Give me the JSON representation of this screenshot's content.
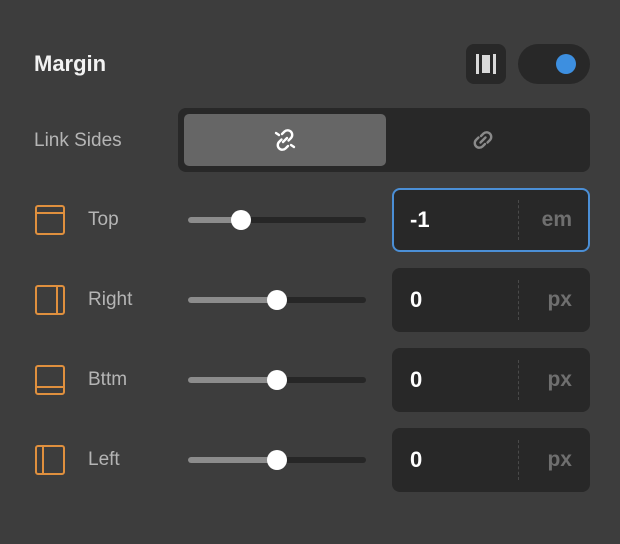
{
  "section": {
    "title": "Margin",
    "spacing_icon": "vertical-spacing-icon",
    "toggle_on": true
  },
  "link_sides": {
    "label": "Link Sides",
    "options": [
      {
        "icon": "unlink-icon",
        "active": true
      },
      {
        "icon": "link-icon",
        "active": false
      }
    ]
  },
  "rows": [
    {
      "label": "Top",
      "icon": "side-top-icon",
      "value": "-1",
      "unit": "em",
      "slider_fraction": 0.3,
      "focused": true
    },
    {
      "label": "Right",
      "icon": "side-right-icon",
      "value": "0",
      "unit": "px",
      "slider_fraction": 0.5,
      "focused": false
    },
    {
      "label": "Bttm",
      "icon": "side-bottom-icon",
      "value": "0",
      "unit": "px",
      "slider_fraction": 0.5,
      "focused": false
    },
    {
      "label": "Left",
      "icon": "side-left-icon",
      "value": "0",
      "unit": "px",
      "slider_fraction": 0.5,
      "focused": false
    }
  ],
  "colors": {
    "accent_icon": "#e0903e",
    "toggle_knob": "#3d8fe0",
    "focus_border": "#4b8fd6"
  }
}
